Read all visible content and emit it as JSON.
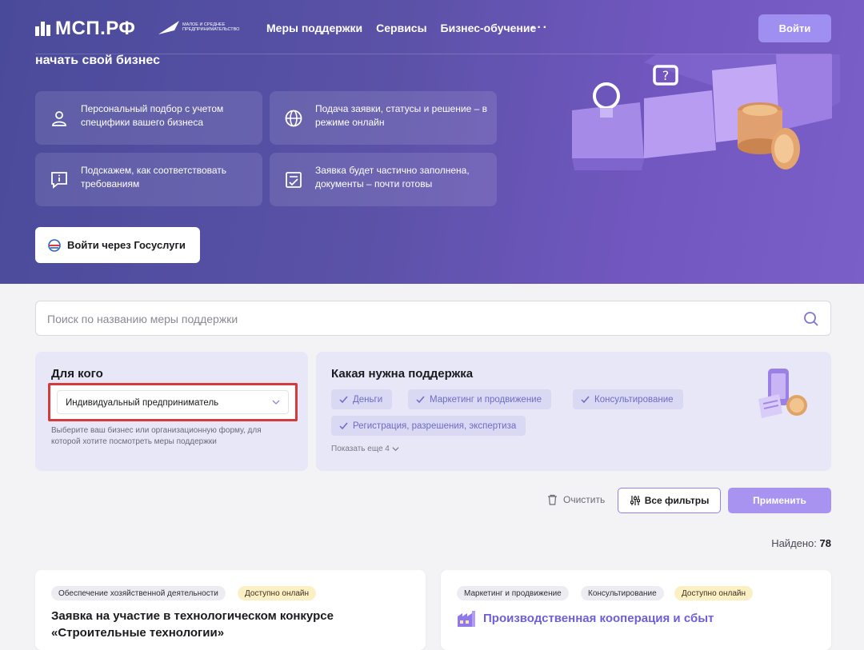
{
  "header": {
    "logo_text": "МСП.РФ",
    "partner_text": "МАЛОЕ И СРЕДНЕЕ ПРЕДПРИНИМАТЕЛЬСТВО",
    "nav": [
      "Меры поддержки",
      "Сервисы",
      "Бизнес-обучение"
    ],
    "more_icon": "ellipsis-icon",
    "login_label": "Войти"
  },
  "hero": {
    "title": "начать свой бизнес",
    "features": [
      {
        "icon": "person-icon",
        "text": "Персональный подбор с учетом специфики вашего бизнеса"
      },
      {
        "icon": "globe-icon",
        "text": "Подача заявки, статусы и решение – в режиме онлайн"
      },
      {
        "icon": "info-chat-icon",
        "text": "Подскажем, как соответствовать требованиям"
      },
      {
        "icon": "checklist-icon",
        "text": "Заявка будет частично заполнена, документы – почти готовы"
      }
    ],
    "gosuslugi_label": "Войти через Госуслуги"
  },
  "search": {
    "placeholder": "Поиск по названию меры поддержки"
  },
  "filters": {
    "for_whom": {
      "title": "Для кого",
      "selected": "Индивидуальный предприниматель",
      "hint": "Выберите ваш бизнес или организационную форму, для которой хотите посмотреть меры поддержки"
    },
    "support": {
      "title": "Какая нужна поддержка",
      "chips": [
        "Деньги",
        "Маркетинг и продвижение",
        "Консультирование",
        "Регистрация, разрешения, экспертиза"
      ],
      "show_more": "Показать еще 4"
    },
    "clear_label": "Очистить",
    "all_filters_label": "Все фильтры",
    "apply_label": "Применить"
  },
  "results": {
    "found_label": "Найдено:",
    "found_count": "78",
    "cards": [
      {
        "tags": [
          "Обеспечение хозяйственной деятельности",
          "Доступно онлайн"
        ],
        "title_line1": "Заявка на участие в технологическом конкурсе",
        "title_line2": "«Строительные технологии»"
      },
      {
        "tags": [
          "Маркетинг и продвижение",
          "Консультирование",
          "Доступно онлайн"
        ],
        "title": "Производственная кооперация и сбыт"
      }
    ]
  },
  "colors": {
    "hero_start": "#4a4a9a",
    "hero_end": "#7a5fc8",
    "accent": "#a894f0",
    "panel": "#e7e7f7",
    "highlight_border": "#d63a3a"
  }
}
